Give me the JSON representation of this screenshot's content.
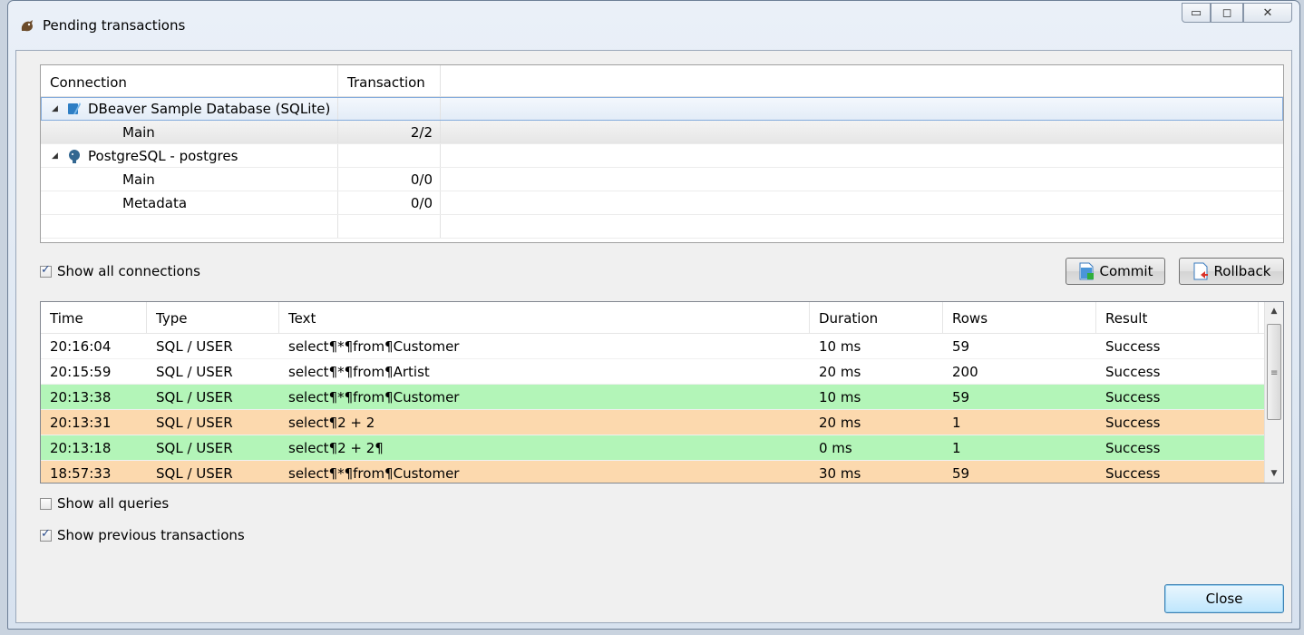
{
  "window": {
    "title": "Pending transactions"
  },
  "conn_table": {
    "headers": [
      "Connection",
      "Transaction"
    ],
    "rows": [
      {
        "label": "DBeaver Sample Database (SQLite)",
        "tx": "",
        "level": 0
      },
      {
        "label": "Main",
        "tx": "2/2",
        "level": 1
      },
      {
        "label": "PostgreSQL - postgres",
        "tx": "",
        "level": 0
      },
      {
        "label": "Main",
        "tx": "0/0",
        "level": 1
      },
      {
        "label": "Metadata",
        "tx": "0/0",
        "level": 1
      }
    ]
  },
  "show_all_connections": {
    "label": "Show all connections",
    "checked": true
  },
  "buttons": {
    "commit": "Commit",
    "rollback": "Rollback",
    "close": "Close"
  },
  "log_table": {
    "headers": {
      "time": "Time",
      "type": "Type",
      "text": "Text",
      "duration": "Duration",
      "rows": "Rows",
      "result": "Result"
    },
    "rows": [
      {
        "time": "20:16:04",
        "type": "SQL / USER",
        "text": "select¶*¶from¶Customer",
        "duration": "10 ms",
        "rows": "59",
        "result": "Success"
      },
      {
        "time": "20:15:59",
        "type": "SQL / USER",
        "text": "select¶*¶from¶Artist",
        "duration": "20 ms",
        "rows": "200",
        "result": "Success"
      },
      {
        "time": "20:13:38",
        "type": "SQL / USER",
        "text": "select¶*¶from¶Customer",
        "duration": "10 ms",
        "rows": "59",
        "result": "Success"
      },
      {
        "time": "20:13:31",
        "type": "SQL / USER",
        "text": "select¶2 + 2",
        "duration": "20 ms",
        "rows": "1",
        "result": "Success"
      },
      {
        "time": "20:13:18",
        "type": "SQL / USER",
        "text": "select¶2 + 2¶",
        "duration": "0 ms",
        "rows": "1",
        "result": "Success"
      },
      {
        "time": "18:57:33",
        "type": "SQL / USER",
        "text": "select¶*¶from¶Customer",
        "duration": "30 ms",
        "rows": "59",
        "result": "Success"
      }
    ]
  },
  "show_all_queries": {
    "label": "Show all queries",
    "checked": false
  },
  "show_previous_transactions": {
    "label": "Show previous transactions",
    "checked": true
  },
  "colors": {
    "green_row": "#b3f5b8",
    "orange_row": "#fcd9ae",
    "selection": "#84acdd"
  }
}
